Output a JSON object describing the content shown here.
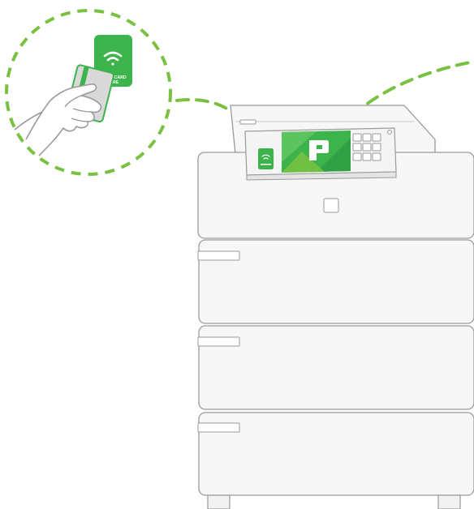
{
  "card_reader": {
    "label_line1": "SWIPE CARD",
    "label_line2": "HERE",
    "wifi_icon": "wifi-icon"
  },
  "panel": {
    "logo_icon": "papercut-logo-icon",
    "keypad_keys": 9
  },
  "drawers": {
    "count": 3
  },
  "colors": {
    "accent_green": "#3cb44b",
    "dash_green": "#7ac142",
    "outline": "#9a9a9a",
    "body_fill": "#f7f7f7"
  }
}
